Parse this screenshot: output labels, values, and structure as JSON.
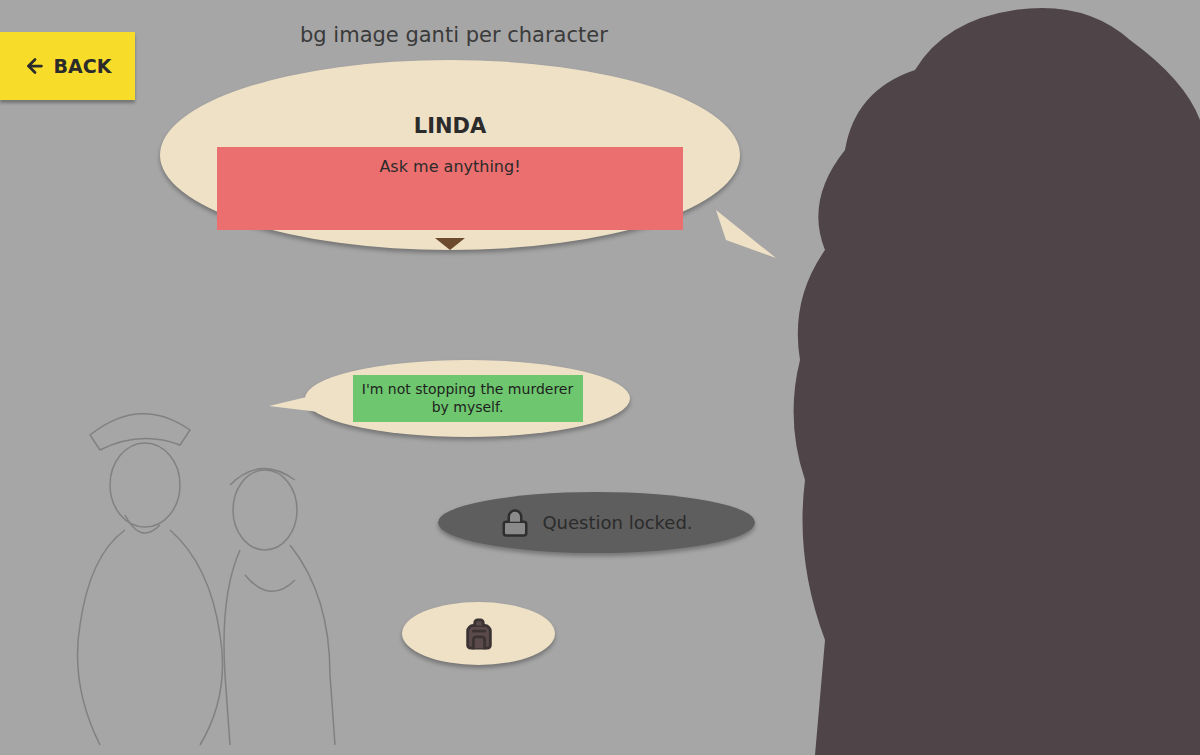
{
  "screen_note": "bg image ganti per character",
  "back_button": {
    "label": "BACK"
  },
  "dialogue": {
    "speaker": "LINDA",
    "text": "Ask me anything!"
  },
  "choices": [
    {
      "kind": "answer",
      "text": "I'm not stopping the murderer by myself.",
      "locked": false
    },
    {
      "kind": "locked",
      "text": "Question locked.",
      "locked": true
    },
    {
      "kind": "inventory",
      "text": "",
      "locked": false
    }
  ]
}
